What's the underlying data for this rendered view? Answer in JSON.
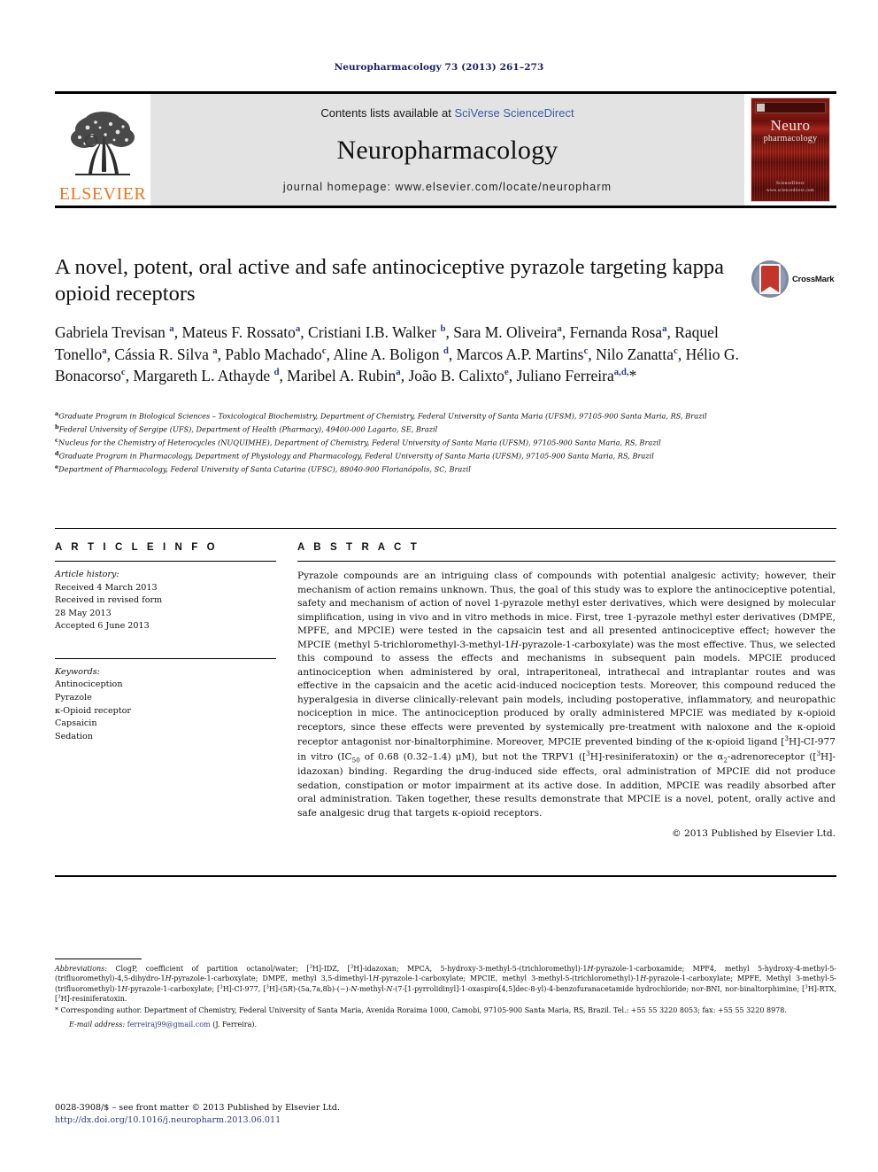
{
  "running_head": "Neuropharmacology 73 (2013) 261–273",
  "masthead": {
    "publisher_name": "ELSEVIER",
    "contents_prefix": "Contents lists available at ",
    "contents_link": "SciVerse ScienceDirect",
    "journal_title": "Neuropharmacology",
    "homepage_label": "journal homepage: www.elsevier.com/locate/neuropharm",
    "cover": {
      "line1": "Neuro",
      "line2": "pharmacology",
      "footer_line1": "ScienceDirect",
      "footer_line2": "www.sciencedirect.com"
    }
  },
  "article": {
    "title": "A novel, potent, oral active and safe antinociceptive pyrazole targeting kappa opioid receptors",
    "crossmark_label": "CrossMark",
    "authors_html": "Gabriela Trevisan <sup>a</sup>, Mateus F. Rossato<sup>a</sup>, Cristiani I.B. Walker <sup>b</sup>, Sara M. Oliveira<sup>a</sup>, Fernanda Rosa<sup>a</sup>, Raquel Tonello<sup>a</sup>, Cássia R. Silva <sup>a</sup>, Pablo Machado<sup>c</sup>, Aline A. Boligon <sup>d</sup>, Marcos A.P. Martins<sup>c</sup>, Nilo Zanatta<sup>c</sup>, Hélio G. Bonacorso<sup>c</sup>, Margareth L. Athayde <sup>d</sup>, Maribel A. Rubin<sup>a</sup>, João B. Calixto<sup>e</sup>, Juliano Ferreira<sup>a,d,</sup>*"
  },
  "affiliations": [
    {
      "marker": "a",
      "text": "Graduate Program in Biological Sciences – Toxicological Biochemistry, Department of Chemistry, Federal University of Santa Maria (UFSM), 97105-900 Santa Maria, RS, Brazil"
    },
    {
      "marker": "b",
      "text": "Federal University of Sergipe (UFS), Department of Health (Pharmacy), 49400-000 Lagarto, SE, Brazil"
    },
    {
      "marker": "c",
      "text": "Nucleus for the Chemistry of Heterocycles (NUQUIMHE), Department of Chemistry, Federal University of Santa Maria (UFSM), 97105-900 Santa Maria, RS, Brazil"
    },
    {
      "marker": "d",
      "text": "Graduate Program in Pharmacology, Department of Physiology and Pharmacology, Federal University of Santa Maria (UFSM), 97105-900 Santa Maria, RS, Brazil"
    },
    {
      "marker": "e",
      "text": "Department of Pharmacology, Federal University of Santa Catarina (UFSC), 88040-900 Florianópolis, SC, Brazil"
    }
  ],
  "article_info": {
    "heading": "A R T I C L E   I N F O",
    "history_label": "Article history:",
    "history": [
      "Received 4 March 2013",
      "Received in revised form",
      "28 May 2013",
      "Accepted 6 June 2013"
    ],
    "keywords_label": "Keywords:",
    "keywords": [
      "Antinociception",
      "Pyrazole",
      "κ-Opioid receptor",
      "Capsaicin",
      "Sedation"
    ]
  },
  "abstract": {
    "heading": "A B S T R A C T",
    "body_html": "Pyrazole compounds are an intriguing class of compounds with potential analgesic activity; however, their mechanism of action remains unknown. Thus, the goal of this study was to explore the antinociceptive potential, safety and mechanism of action of novel 1-pyrazole methyl ester derivatives, which were designed by molecular simplification, using in vivo and in vitro methods in mice. First, tree 1-pyrazole methyl ester derivatives (DMPE, MPFE, and MPCIE) were tested in the capsaicin test and all presented antinociceptive effect; however the MPCIE (methyl 5-trichloromethyl-3-methyl-1<i>H</i>-pyrazole-1-carboxylate) was the most effective. Thus, we selected this compound to assess the effects and mechanisms in subsequent pain models. MPCIE produced antinociception when administered by oral, intraperitoneal, intrathecal and intraplantar routes and was effective in the capsaicin and the acetic acid-induced nociception tests. Moreover, this compound reduced the hyperalgesia in diverse clinically-relevant pain models, including postoperative, inflammatory, and neuropathic nociception in mice. The antinociception produced by orally administered MPCIE was mediated by κ-opioid receptors, since these effects were prevented by systemically pre-treatment with naloxone and the κ-opioid receptor antagonist nor-binaltorphimine. Moreover, MPCIE prevented binding of the κ-opioid ligand [<sup>3</sup>H]-CI-977 in vitro (IC<sub>50</sub> of 0.68 (0.32–1.4) μM), but not the TRPV1 ([<sup>3</sup>H]-resiniferatoxin) or the α<sub>2</sub>-adrenoreceptor ([<sup>3</sup>H]-idazoxan) binding. Regarding the drug-induced side effects, oral administration of MPCIE did not produce sedation, constipation or motor impairment at its active dose. In addition, MPCIE was readily absorbed after oral administration. Taken together, these results demonstrate that MPCIE is a novel, potent, orally active and safe analgesic drug that targets κ-opioid receptors.",
    "copyright": "© 2013 Published by Elsevier Ltd."
  },
  "footnotes": {
    "abbreviations_html": "<span class=\"it\">Abbreviations:</span> ClogP, coefficient of partition octanol/water; [<sup>3</sup>H]-IDZ, [<sup>3</sup>H]-idazoxan; MPCA, 5-hydroxy-3-methyl-5-(trichloromethyl)-1<i>H</i>-pyrazole-1-carboxamide; MPF4, methyl 5-hydroxy-4-methyl-5-(trifluoromethyl)-4,5-dihydro-1<i>H</i>-pyrazole-1-carboxylate; DMPE, methyl 3,5-dimethyl-1<i>H</i>-pyrazole-1-carboxylate; MPCIE, methyl 3-methyl-5-(trichloromethyl)-1<i>H</i>-pyrazole-1-carboxylate; MPFE, Methyl 3-methyl-5-(trifluoromethyl)-1<i>H</i>-pyrazole-1-carboxylate; [<sup>3</sup>H]-CI-977, [<sup>3</sup>H]-(5<i>R</i>)-(5a,7a,8b)-(−)-<i>N</i>-methyl-<i>N</i>-(7-[1-pyrrolidinyl]-1-oxaspiro[4,5]dec-8-yl)-4-benzofuranacetamide hydrochloride; nor-BNI, nor-binaltorphimine; [<sup>3</sup>H]-RTX, [<sup>3</sup>H]-resiniferatoxin.",
    "corresponding_html": "* Corresponding author. Department of Chemistry, Federal University of Santa Maria, Avenida Roraima 1000, Camobi, 97105-900 Santa Maria, RS, Brazil. Tel.: +55 55 3220 8053; fax: +55 55 3220 8978.",
    "email_label": "E-mail address:",
    "email_address": "ferreiraj99@gmail.com",
    "email_owner": "(J. Ferreira)."
  },
  "imprint": {
    "line1": "0028-3908/$ – see front matter © 2013 Published by Elsevier Ltd.",
    "doi": "http://dx.doi.org/10.1016/j.neuropharm.2013.06.011"
  }
}
